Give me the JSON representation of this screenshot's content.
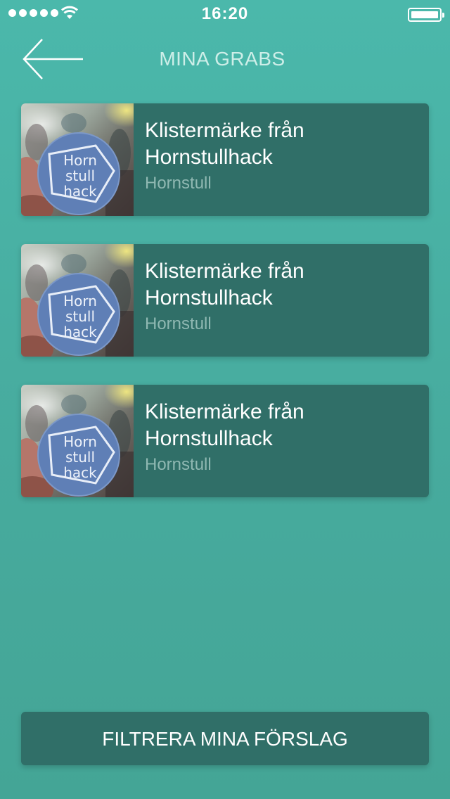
{
  "status_bar": {
    "time": "16:20",
    "signal_dots": 5
  },
  "header": {
    "title": "MINA GRABS",
    "back_icon": "arrow-left-icon"
  },
  "grabs": [
    {
      "title": "Klistermärke från Hornstullhack",
      "location": "Hornstull",
      "sticker_lines": [
        "Horn",
        "stull",
        "hack"
      ]
    },
    {
      "title": "Klistermärke från Hornstullhack",
      "location": "Hornstull",
      "sticker_lines": [
        "Horn",
        "stull",
        "hack"
      ]
    },
    {
      "title": "Klistermärke från Hornstullhack",
      "location": "Hornstull",
      "sticker_lines": [
        "Horn",
        "stull",
        "hack"
      ]
    }
  ],
  "footer": {
    "filter_label": "FILTRERA MINA FÖRSLAG"
  },
  "colors": {
    "background": "#48b0a3",
    "card": "#306f68",
    "title_text": "#cdeee8",
    "subtitle_text": "#8fb8b2"
  }
}
